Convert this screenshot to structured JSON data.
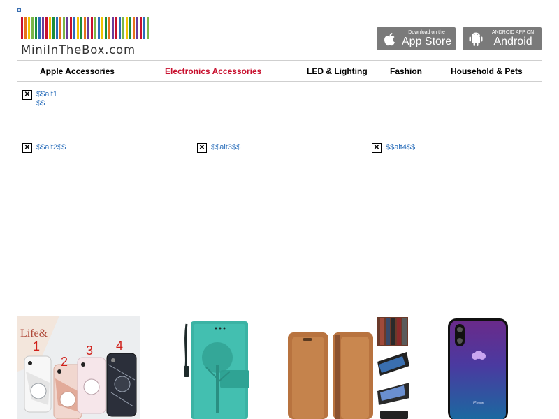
{
  "header": {
    "logo_text": "MiniInTheBox.com",
    "logo_colors": [
      "#c8102e",
      "#e8731a",
      "#f2c300",
      "#7ab648",
      "#1c8e3c",
      "#2a6ebb",
      "#6a3d9a",
      "#c8102e",
      "#f2c300",
      "#1c8e3c",
      "#2a6ebb",
      "#e8731a",
      "#7ab648",
      "#6a3d9a",
      "#c8102e",
      "#2a6ebb",
      "#f2c300",
      "#1c8e3c",
      "#e8731a",
      "#6a3d9a",
      "#c8102e",
      "#7ab648",
      "#2a6ebb",
      "#f2c300",
      "#1c8e3c",
      "#e8731a",
      "#6a3d9a",
      "#c8102e",
      "#2a6ebb",
      "#7ab648",
      "#f2c300",
      "#1c8e3c",
      "#e8731a",
      "#6a3d9a",
      "#c8102e",
      "#2a6ebb",
      "#7ab648"
    ],
    "app_store": {
      "small": "Download on the",
      "big": "App Store",
      "icon": "apple-icon"
    },
    "android": {
      "small": "ANDROID APP ON",
      "big": "Android",
      "icon": "android-icon"
    }
  },
  "nav": {
    "items": [
      {
        "label": "Apple Accessories",
        "active": false
      },
      {
        "label": "Electronics Accessories",
        "active": true
      },
      {
        "label": "LED & Lighting",
        "active": false
      },
      {
        "label": "Fashion",
        "active": false
      },
      {
        "label": "Household & Pets",
        "active": false
      }
    ],
    "active_color": "#c8102e"
  },
  "placeholders": {
    "alt1_line1": "$$alt1",
    "alt1_line2": "$$",
    "alt2": "$$alt2$$",
    "alt3": "$$alt3$$",
    "alt4": "$$alt4$$",
    "icon": "broken-image-icon",
    "x_glyph": "✕"
  },
  "products": {
    "p1": {
      "numbers": [
        "1",
        "2",
        "3",
        "4"
      ],
      "text": "Life&"
    },
    "p4": {
      "text": "iPhone"
    }
  }
}
